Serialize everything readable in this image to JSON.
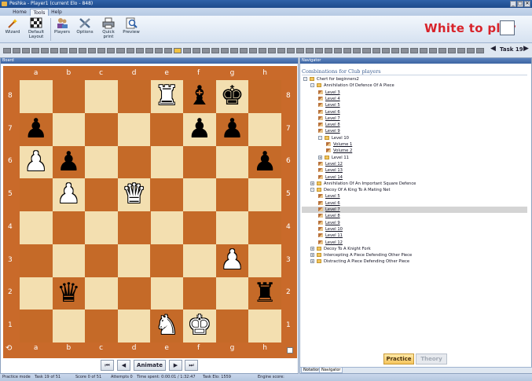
{
  "window": {
    "title": "Peshka - Player1 (current Elo - 848)",
    "buttons": [
      "_",
      "□",
      "✕"
    ]
  },
  "ribbon_tabs": [
    "Home",
    "Tools",
    "Help"
  ],
  "ribbon": {
    "buttons": [
      {
        "label": "Wizard",
        "icon": "wand-icon"
      },
      {
        "label": "Default Layout",
        "icon": "layout-icon"
      },
      {
        "label": "Players",
        "icon": "players-icon"
      },
      {
        "label": "Options",
        "icon": "options-icon"
      },
      {
        "label": "Quick print",
        "icon": "printer-icon"
      },
      {
        "label": "Preview",
        "icon": "preview-icon"
      }
    ],
    "turn_text": "White to play"
  },
  "progress": {
    "task_label": "Task 19",
    "segments_total": 51,
    "current": 19
  },
  "board_panel": {
    "title": "Board"
  },
  "board": {
    "files": [
      "a",
      "b",
      "c",
      "d",
      "e",
      "f",
      "g",
      "h"
    ],
    "ranks": [
      "8",
      "7",
      "6",
      "5",
      "4",
      "3",
      "2",
      "1"
    ],
    "pieces": [
      {
        "square": "e8",
        "glyph": "♜",
        "color": "w"
      },
      {
        "square": "f8",
        "glyph": "♝",
        "color": "b"
      },
      {
        "square": "g8",
        "glyph": "♚",
        "color": "b"
      },
      {
        "square": "a7",
        "glyph": "♟",
        "color": "b"
      },
      {
        "square": "f7",
        "glyph": "♟",
        "color": "b"
      },
      {
        "square": "g7",
        "glyph": "♟",
        "color": "b"
      },
      {
        "square": "a6",
        "glyph": "♟",
        "color": "w"
      },
      {
        "square": "b6",
        "glyph": "♟",
        "color": "b"
      },
      {
        "square": "h6",
        "glyph": "♟",
        "color": "b"
      },
      {
        "square": "b5",
        "glyph": "♟",
        "color": "w"
      },
      {
        "square": "d5",
        "glyph": "♛",
        "color": "w"
      },
      {
        "square": "g3",
        "glyph": "♟",
        "color": "w"
      },
      {
        "square": "b2",
        "glyph": "♛",
        "color": "b"
      },
      {
        "square": "h2",
        "glyph": "♜",
        "color": "b"
      },
      {
        "square": "e1",
        "glyph": "♞",
        "color": "w"
      },
      {
        "square": "f1",
        "glyph": "♚",
        "color": "w"
      }
    ]
  },
  "controls": {
    "first": "⏮",
    "prev": "◀",
    "animate": "Animate",
    "next": "▶",
    "last": "⏭"
  },
  "navigator": {
    "title": "Navigator",
    "heading": "Combinations for Club players",
    "tree": [
      {
        "level": 0,
        "type": "folder",
        "label": "Chert for beginners2",
        "exp": "-"
      },
      {
        "level": 1,
        "type": "folder",
        "label": "Annihilation Of Defence Of A Piece",
        "exp": "-"
      },
      {
        "level": 2,
        "type": "item",
        "label": "Level 3"
      },
      {
        "level": 2,
        "type": "item",
        "label": "Level 4"
      },
      {
        "level": 2,
        "type": "item",
        "label": "Level 5"
      },
      {
        "level": 2,
        "type": "item",
        "label": "Level 6"
      },
      {
        "level": 2,
        "type": "item",
        "label": "Level 7"
      },
      {
        "level": 2,
        "type": "item",
        "label": "Level 8"
      },
      {
        "level": 2,
        "type": "item",
        "label": "Level 9"
      },
      {
        "level": 2,
        "type": "folder",
        "label": "Level 10",
        "exp": "-"
      },
      {
        "level": 3,
        "type": "item",
        "label": "Volume 1"
      },
      {
        "level": 3,
        "type": "item",
        "label": "Volume 2"
      },
      {
        "level": 2,
        "type": "folder",
        "label": "Level 11",
        "exp": "+"
      },
      {
        "level": 2,
        "type": "item",
        "label": "Level 12"
      },
      {
        "level": 2,
        "type": "item",
        "label": "Level 13"
      },
      {
        "level": 2,
        "type": "item",
        "label": "Level 14"
      },
      {
        "level": 1,
        "type": "folder",
        "label": "Annihilation Of An Important Square Defence",
        "exp": "+"
      },
      {
        "level": 1,
        "type": "folder",
        "label": "Decoy Of A King To A Mating Net",
        "exp": "-"
      },
      {
        "level": 2,
        "type": "item",
        "label": "Level 5"
      },
      {
        "level": 2,
        "type": "item",
        "label": "Level 6"
      },
      {
        "level": 2,
        "type": "item",
        "label": "Level 7",
        "selected": true
      },
      {
        "level": 2,
        "type": "item",
        "label": "Level 8"
      },
      {
        "level": 2,
        "type": "item",
        "label": "Level 9"
      },
      {
        "level": 2,
        "type": "item",
        "label": "Level 10"
      },
      {
        "level": 2,
        "type": "item",
        "label": "Level 11"
      },
      {
        "level": 2,
        "type": "item",
        "label": "Level 12"
      },
      {
        "level": 1,
        "type": "folder",
        "label": "Decoy To A Knight Fork",
        "exp": "+"
      },
      {
        "level": 1,
        "type": "folder",
        "label": "Intercepting A Piece Defending Other Piece",
        "exp": "+"
      },
      {
        "level": 1,
        "type": "folder",
        "label": "Distracting A Piece Defending Other Piece",
        "exp": "+"
      }
    ],
    "practice_label": "Practice",
    "theory_label": "Theory",
    "bottom_tabs": [
      "Notation",
      "Navigator"
    ]
  },
  "status": {
    "mode": "Practice mode",
    "task": "Task 19 of 51",
    "score": "Score 0 of 51",
    "attempts": "Attempts 0",
    "time": "Time spent: 0:00:01 / 1:32:47",
    "task_elo": "Task Elo: 1559",
    "engine": "Engine score:"
  }
}
